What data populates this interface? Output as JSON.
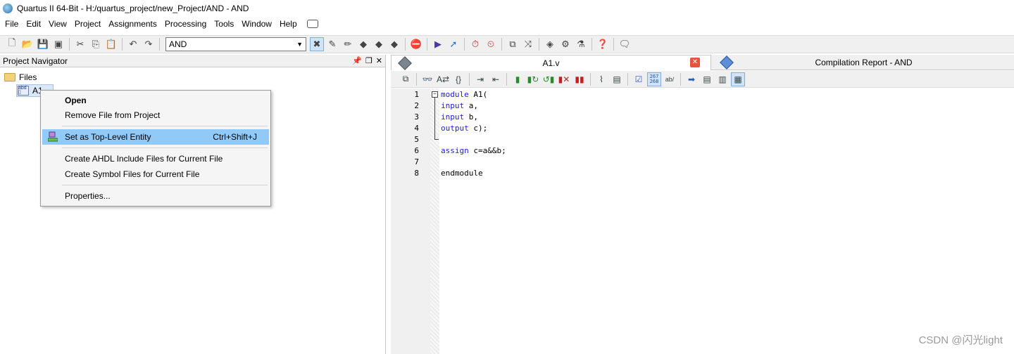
{
  "window": {
    "title": "Quartus II 64-Bit - H:/quartus_project/new_Project/AND - AND"
  },
  "menu": [
    "File",
    "Edit",
    "View",
    "Project",
    "Assignments",
    "Processing",
    "Tools",
    "Window",
    "Help"
  ],
  "toolbar": {
    "entity_select": "AND"
  },
  "navigator": {
    "title": "Project Navigator",
    "folder_label": "Files",
    "file_label": "A1"
  },
  "context_menu": {
    "items": [
      {
        "label": "Open",
        "bold": true
      },
      {
        "label": "Remove File from Project"
      },
      {
        "label": "Set as Top-Level Entity",
        "shortcut": "Ctrl+Shift+J",
        "highlighted": true
      },
      {
        "label": "Create AHDL Include Files for Current File"
      },
      {
        "label": "Create Symbol Files for Current File"
      },
      {
        "label": "Properties..."
      }
    ]
  },
  "tabs": [
    {
      "label": "A1.v",
      "active": true
    },
    {
      "label": "Compilation Report - AND",
      "active": false
    }
  ],
  "editor": {
    "line_numbers": [
      "1",
      "2",
      "3",
      "4",
      "5",
      "6",
      "7",
      "8"
    ],
    "lines": [
      {
        "kw": "module",
        "rest": " A1("
      },
      {
        "kw": "input",
        "rest": " a,"
      },
      {
        "kw": "input",
        "rest": " b,"
      },
      {
        "kw": "output",
        "rest": " c);"
      },
      {
        "kw": "",
        "rest": ""
      },
      {
        "kw": "assign",
        "rest": " c=a&&b;"
      },
      {
        "kw": "",
        "rest": ""
      },
      {
        "kw": "",
        "rest": "endmodule"
      }
    ]
  },
  "watermark": "CSDN @闪光light",
  "colors": {
    "keyword": "#1a1adb",
    "menu_highlight": "#91c9f7",
    "close_tab": "#e8533d"
  }
}
